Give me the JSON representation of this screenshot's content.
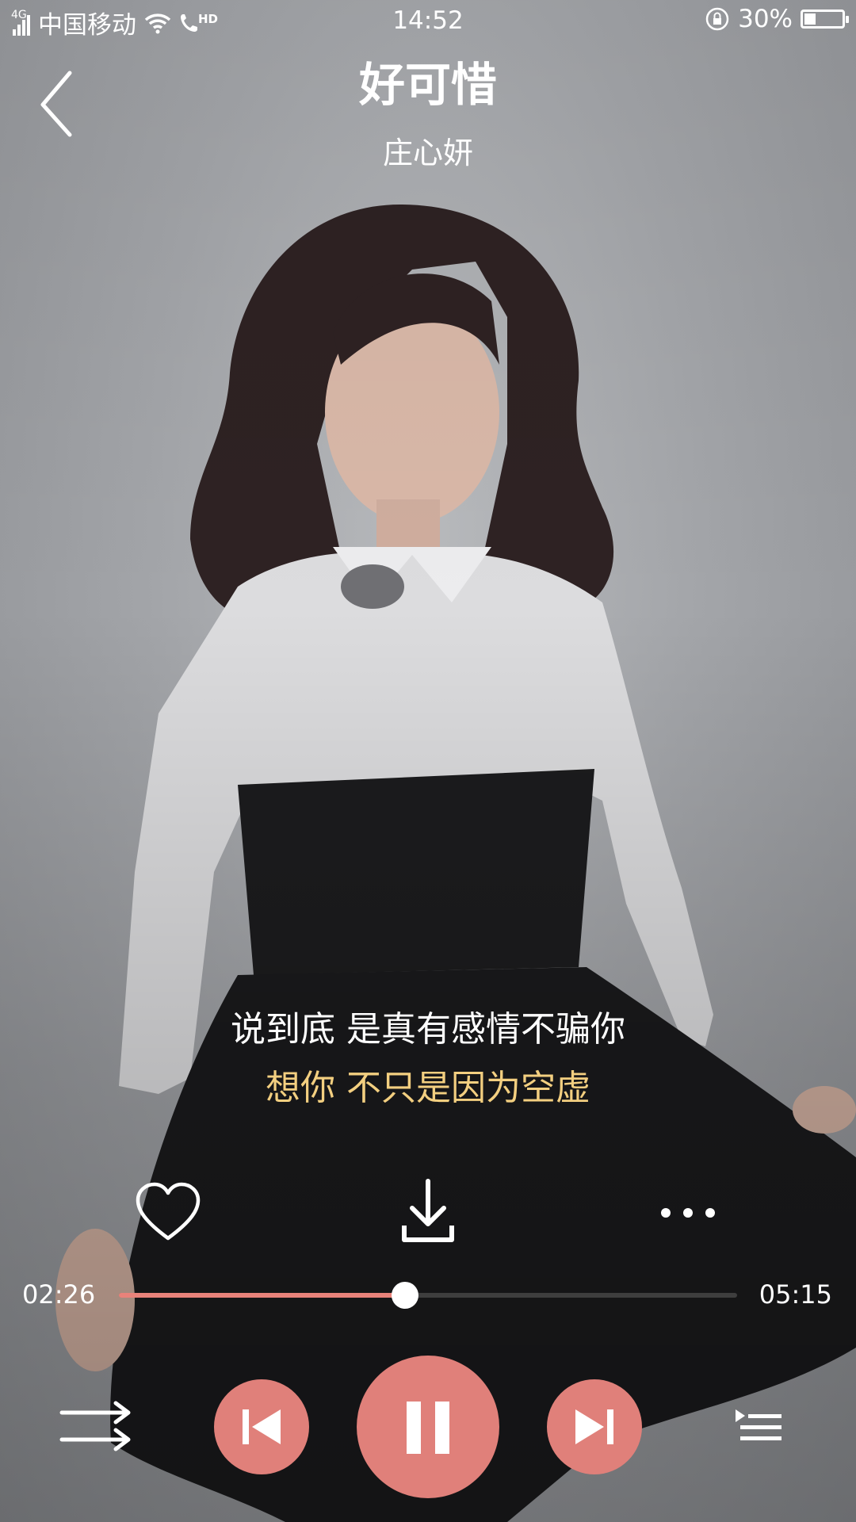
{
  "status_bar": {
    "network": "4G",
    "carrier": "中国移动",
    "hd_label": "HD",
    "time": "14:52",
    "battery": "30%",
    "battery_level": 0.3,
    "icons": [
      "signal-icon",
      "wifi-icon",
      "hd-call-icon",
      "rotation-lock-icon",
      "battery-icon"
    ]
  },
  "header": {
    "back_icon": "chevron-left-icon",
    "title": "好可惜",
    "artist": "庄心妍"
  },
  "lyrics": {
    "previous_line": "说到底 是真有感情不骗你",
    "current_line": "想你 不只是因为空虚"
  },
  "actions": {
    "icons": [
      "heart-icon",
      "download-icon",
      "more-icon"
    ]
  },
  "progress": {
    "elapsed": "02:26",
    "total": "05:15",
    "fraction": 0.463
  },
  "controls": {
    "icons": [
      "shuffle-icon",
      "previous-icon",
      "pause-icon",
      "next-icon",
      "playlist-icon"
    ]
  },
  "colors": {
    "accent": "#e0807a",
    "lyric_highlight": "#f3cf80",
    "text": "#ffffff"
  }
}
